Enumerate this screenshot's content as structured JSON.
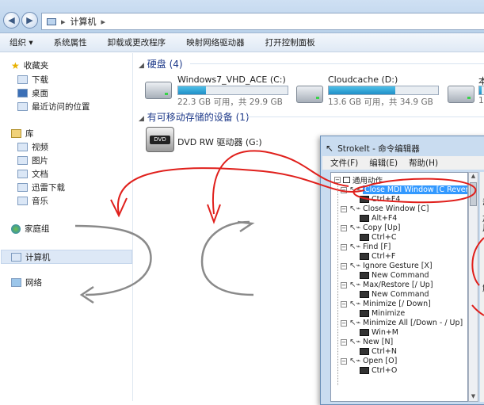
{
  "window": {
    "breadcrumb": "计算机",
    "breadcrumb_sep": "▸"
  },
  "toolbar": {
    "items": [
      "组织 ▾",
      "系统属性",
      "卸载或更改程序",
      "映射网络驱动器",
      "打开控制面板"
    ]
  },
  "nav": {
    "favorites": "收藏夹",
    "fav_items": [
      "下载",
      "桌面",
      "最近访问的位置"
    ],
    "libraries": "库",
    "lib_items": [
      "视频",
      "图片",
      "文档",
      "迅雷下载",
      "音乐"
    ],
    "homegroup": "家庭组",
    "computer": "计算机",
    "network": "网络"
  },
  "main": {
    "hdd_section": "硬盘 (4)",
    "removable_section": "有可移动存储的设备 (1)",
    "drives": [
      {
        "name": "Windows7_VHD_ACE (C:)",
        "info": "22.3 GB 可用，共 29.9 GB",
        "used_fraction": 0.25
      },
      {
        "name": "Cloudcache (D:)",
        "info": "13.6 GB 可用，共 34.9 GB",
        "used_fraction": 0.61
      },
      {
        "name": "本",
        "info": "1",
        "used_fraction": 0.4
      }
    ],
    "dvd": {
      "name": "DVD RW 驱动器 (G:)",
      "label": "DVD"
    }
  },
  "strokeit": {
    "title": "StrokeIt - 命令编辑器",
    "menu": [
      "文件(F)",
      "编辑(E)",
      "帮助(H)"
    ],
    "right_chars": [
      "动",
      "加",
      "用",
      "触"
    ],
    "tree_root": "通用动作",
    "actions": [
      {
        "gesture": "Close MDI Window [C Reverse]",
        "command": "Ctrl+F4"
      },
      {
        "gesture": "Close Window [C]",
        "command": "Alt+F4"
      },
      {
        "gesture": "Copy [Up]",
        "command": "Ctrl+C"
      },
      {
        "gesture": "Find [F]",
        "command": "Ctrl+F"
      },
      {
        "gesture": "Ignore Gesture [X]",
        "command": "New Command"
      },
      {
        "gesture": "Max/Restore [/ Up]",
        "command": "New Command"
      },
      {
        "gesture": "Minimize [/ Down]",
        "command": "Minimize"
      },
      {
        "gesture": "Minimize All [/Down - / Up]",
        "command": "Win+M"
      },
      {
        "gesture": "New [N]",
        "command": "Ctrl+N"
      },
      {
        "gesture": "Open [O]",
        "command": "Ctrl+O"
      }
    ]
  },
  "colors": {
    "annotation_red": "#e0201c",
    "annotation_gray": "#8a8a8a",
    "drive_fill": "#1f8fc7",
    "selection": "#3399ff"
  }
}
